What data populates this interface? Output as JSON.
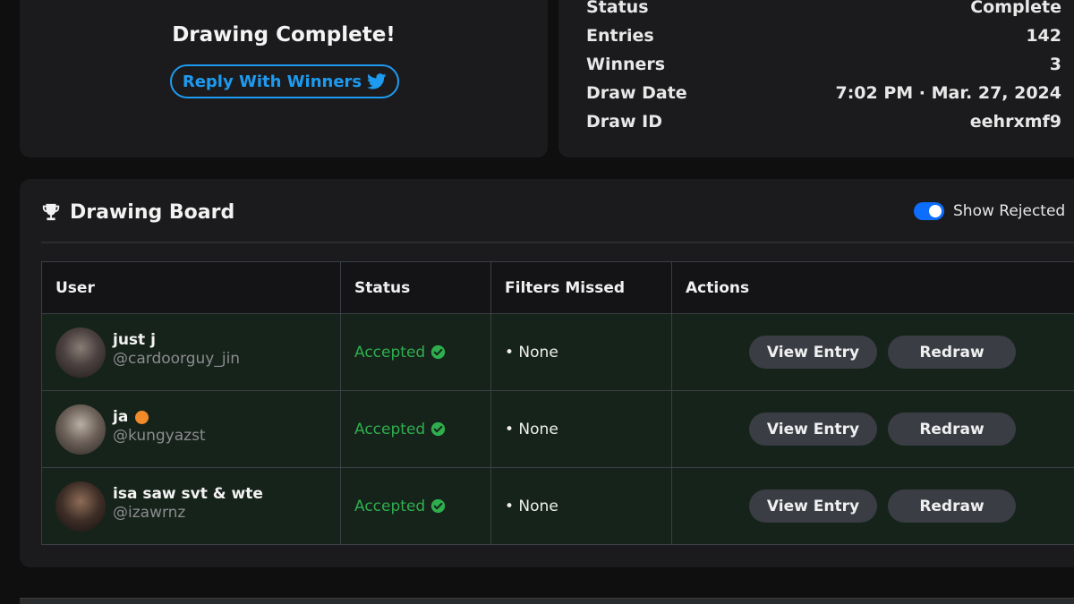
{
  "summary": {
    "title": "Drawing Complete!",
    "reply_label": "Reply With Winners"
  },
  "info": [
    {
      "label": "Status",
      "value": "Complete"
    },
    {
      "label": "Entries",
      "value": "142"
    },
    {
      "label": "Winners",
      "value": "3"
    },
    {
      "label": "Draw Date",
      "value": "7:02 PM · Mar. 27, 2024"
    },
    {
      "label": "Draw ID",
      "value": "eehrxmf9"
    }
  ],
  "board": {
    "title": "Drawing Board",
    "toggle_label": "Show Rejected",
    "toggle_on": true,
    "columns": [
      "User",
      "Status",
      "Filters Missed",
      "Actions"
    ],
    "rows": [
      {
        "name": "just j",
        "handle": "@cardoorguy_jin",
        "status": "Accepted",
        "filters": "• None",
        "view": "View Entry",
        "redraw": "Redraw"
      },
      {
        "name": "ja",
        "handle": "@kungyazst",
        "status": "Accepted",
        "filters": "• None",
        "view": "View Entry",
        "redraw": "Redraw"
      },
      {
        "name": "isa saw svt & wte",
        "handle": "@izawrnz",
        "status": "Accepted",
        "filters": "• None",
        "view": "View Entry",
        "redraw": "Redraw"
      }
    ]
  },
  "colors": {
    "accent": "#1d9bf0",
    "accepted": "#2fae4e",
    "toggle": "#0d6efd",
    "badge": "#f08a2a"
  },
  "icons": [
    "twitter-icon",
    "trophy-icon",
    "check-circle-icon"
  ]
}
